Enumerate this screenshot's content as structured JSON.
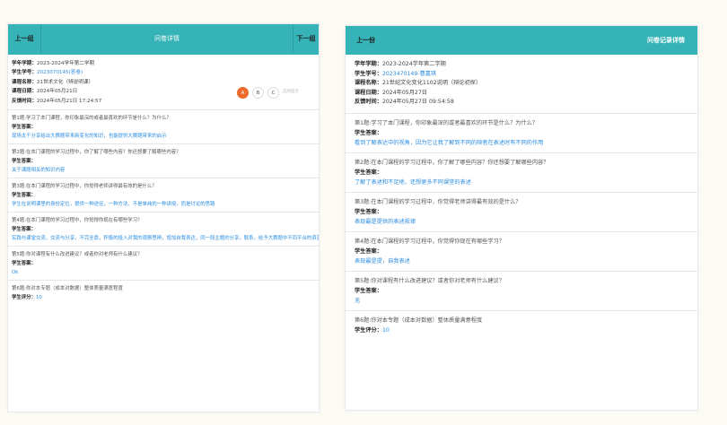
{
  "left": {
    "prev_label": "上一组",
    "title": "问卷详情",
    "next_label": "下一组",
    "info": [
      {
        "key": "学年学期：",
        "value": "2023-2024学年第二学期",
        "link": false
      },
      {
        "key": "学生学号：",
        "value": "2023070145(答卷)",
        "link": true
      },
      {
        "key": "课程名称：",
        "value": "21世术文化（辨说明课）",
        "link": false
      },
      {
        "key": "课程日期：",
        "value": "2024年05月21日",
        "link": false
      },
      {
        "key": "反馈时间：",
        "value": "2024年05月21日 17:24:57",
        "link": false
      }
    ],
    "options": [
      "A",
      "B",
      "C"
    ],
    "option_extra": "选项提示",
    "qa": [
      {
        "q": "第1题:学习了本门课程，你印象最深的或者最喜欢的环节是什么？为什么？",
        "label": "学生答案：",
        "a": "现场太千分享给出大赛题带来新变化的知识，也能提供大赛题带来的启示"
      },
      {
        "q": "第2题:在本门课程的学习过程中，你了解了哪些内容？你还想要了解哪些内容？",
        "label": "学生答案：",
        "a": "关于课题相关的知识内容"
      },
      {
        "q": "第3题:在本门课程的学习过程中，你觉得老师讲得最有效的是什么？",
        "label": "学生答案：",
        "a": "学生在说明课里的身份定位，提供一种途径，一种方法，不是单纯的一种讲授，而是讨论的思路"
      },
      {
        "q": "第4题:在本门课程的学习过程中，你觉得你现在有哪些学习？",
        "label": "学生答案：",
        "a": "实践与课堂交流，交流与分享，不完全靠，积极的投入对我的观察思辨，增加自我表达，同一段主题的分享，联系，给予大赛题中不同平台的资源进行的理解，活跃讨论的热情（课程）"
      },
      {
        "q": "第5题:你对课程有什么改进建议？或者你对老师有什么建议？",
        "label": "学生答案：",
        "a": "Ok"
      },
      {
        "q": "第6题:你对本专题（成本对数据）整体质量满意程度",
        "label": "学生评分：",
        "a": "10",
        "score": true
      }
    ]
  },
  "right": {
    "prev_label": "上一份",
    "title": "问卷记录详情",
    "info": [
      {
        "key": "学年学期：",
        "value": "2023-2024学年第二学期",
        "link": false
      },
      {
        "key": "学生学号：",
        "value": "2023470149-曹嘉琪",
        "link": true
      },
      {
        "key": "课程名称：",
        "value": "21世纪文化变化1102说明（辩论初探）",
        "link": false
      },
      {
        "key": "课程日期：",
        "value": "2024年05月27日",
        "link": false
      },
      {
        "key": "反馈时间：",
        "value": "2024年05月27日 09:54:58",
        "link": false
      }
    ],
    "qa": [
      {
        "q": "第1题:学习了本门课程，你印象最深的或者最喜欢的环节是什么？为什么？",
        "label": "学生答案：",
        "a": "看到了解表达中的视角，因为它让我了解到不同的辩者在表述时有不同的作用"
      },
      {
        "q": "第2题:在本门课程的学习过程中，你了解了哪些内容？你还想要了解哪些内容？",
        "label": "学生答案：",
        "a": "了解了表述和不足地，还想更多不同课堂的表述"
      },
      {
        "q": "第3题:在本门课程的学习过程中，你觉得老师讲得最有效的是什么？",
        "label": "学生答案：",
        "a": "表现最是提供的表述规律"
      },
      {
        "q": "第4题:在本门课程的学习过程中，你觉得你现在有哪些学习？",
        "label": "学生答案：",
        "a": "表现最是提，自我表述"
      },
      {
        "q": "第5题:你对课程有什么改进建议？或者你对老师有什么建议？",
        "label": "学生答案：",
        "a": "无"
      },
      {
        "q": "第6题:你对本专题（成本对数据）整体质量满意程度",
        "label": "学生评分：",
        "a": "10",
        "score": true
      }
    ]
  },
  "colors": {
    "header": "#35b3b6",
    "link": "#2c8de0",
    "selected_option": "#ee6a2a"
  }
}
